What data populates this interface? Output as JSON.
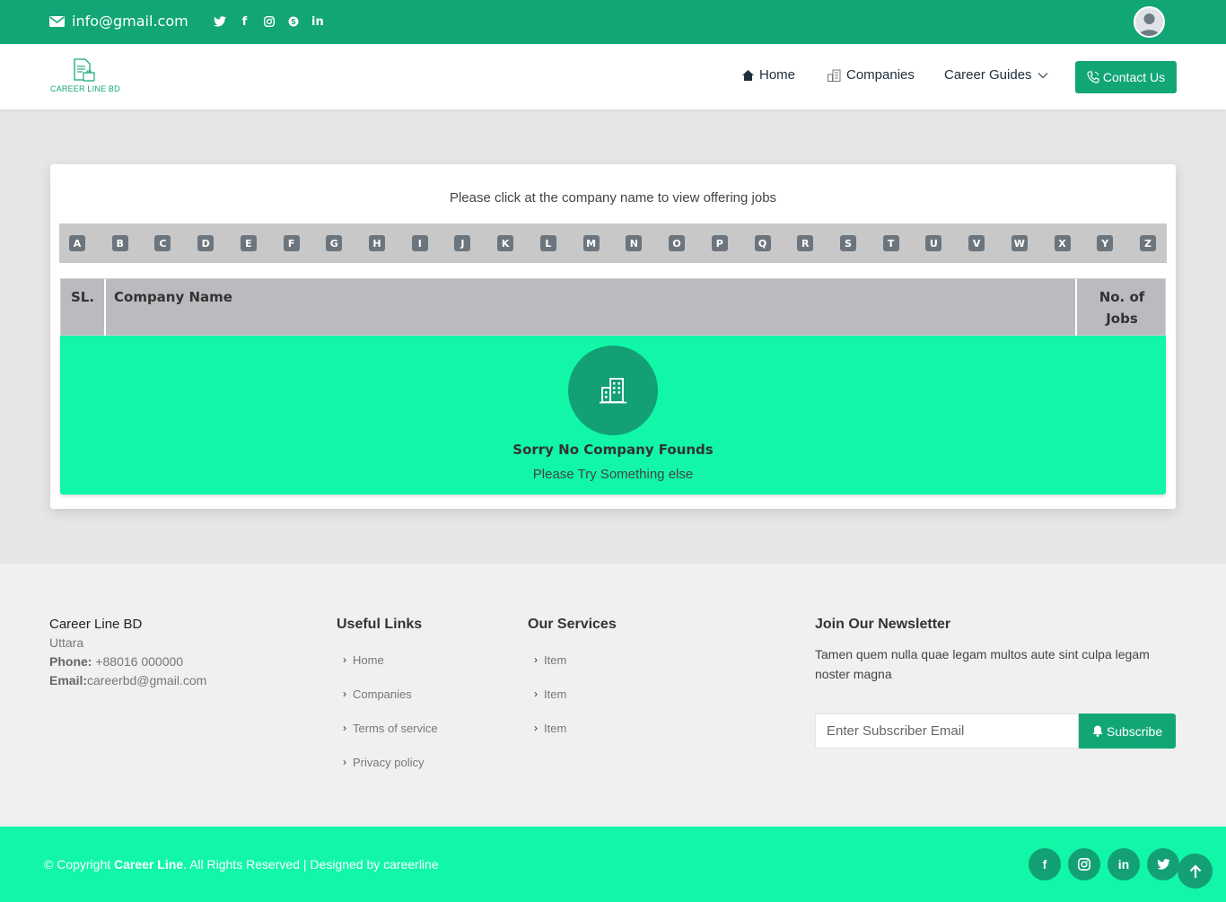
{
  "topbar": {
    "email": "info@gmail.com",
    "social_icons": [
      "twitter-icon",
      "facebook-icon",
      "instagram-icon",
      "skype-icon",
      "linkedin-icon"
    ]
  },
  "header": {
    "logo_text": "CAREER LINE BD",
    "nav": {
      "home": "Home",
      "companies": "Companies",
      "career_guides": "Career Guides",
      "contact": "Contact Us"
    }
  },
  "main": {
    "instruction": "Please click at the company name to view offering jobs",
    "letters": [
      "A",
      "B",
      "C",
      "D",
      "E",
      "F",
      "G",
      "H",
      "I",
      "J",
      "K",
      "L",
      "M",
      "N",
      "O",
      "P",
      "Q",
      "R",
      "S",
      "T",
      "U",
      "V",
      "W",
      "X",
      "Y",
      "Z"
    ],
    "table": {
      "col_sl": "SL.",
      "col_name": "Company Name",
      "col_jobs_line1": "No. of",
      "col_jobs_line2": "Jobs"
    },
    "empty": {
      "title": "Sorry No Company Founds",
      "subtitle": "Please Try Something else"
    }
  },
  "footer": {
    "company": {
      "name": "Career Line BD",
      "city": "Uttara",
      "phone_label": "Phone:",
      "phone": " +88016 000000",
      "email_label": "Email:",
      "email": "careerbd@gmail.com"
    },
    "useful_links": {
      "title": "Useful Links",
      "items": [
        "Home",
        "Companies",
        "Terms of service",
        "Privacy policy"
      ]
    },
    "services": {
      "title": "Our Services",
      "items": [
        "Item",
        "Item",
        "Item"
      ]
    },
    "newsletter": {
      "title": "Join Our Newsletter",
      "description": "Tamen quem nulla quae legam multos aute sint culpa legam noster magna",
      "placeholder": "Enter Subscriber Email",
      "button": "Subscribe"
    },
    "bottom": {
      "copy_prefix": "© Copyright ",
      "brand": "Career Line",
      "copy_suffix": ". All Rights Reserved | Designed by careerline"
    }
  },
  "colors": {
    "primary": "#12a677",
    "accent": "#11f7a7",
    "table_head": "#b9bbbe"
  }
}
